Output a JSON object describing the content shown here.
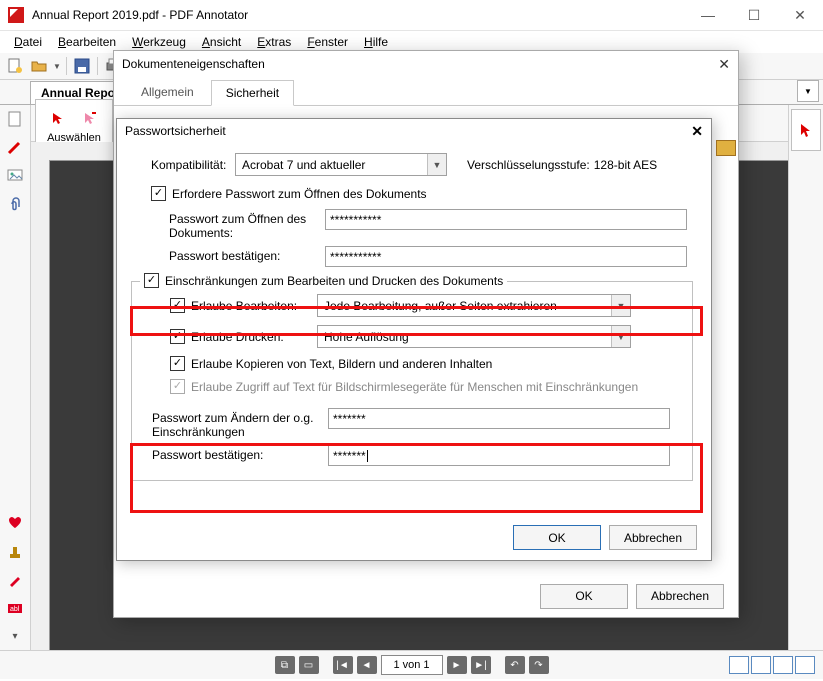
{
  "app": {
    "title": "Annual Report 2019.pdf - PDF Annotator"
  },
  "menubar": [
    "Datei",
    "Bearbeiten",
    "Werkzeug",
    "Ansicht",
    "Extras",
    "Fenster",
    "Hilfe"
  ],
  "doc_tab": "Annual Report",
  "tool_label": "Auswählen",
  "dlg_props": {
    "title": "Dokumenteneigenschaften",
    "tabs": [
      "Allgemein",
      "Sicherheit"
    ],
    "active_tab_index": 1,
    "ok": "OK",
    "cancel": "Abbrechen"
  },
  "dlg_sec": {
    "title": "Passwortsicherheit",
    "compat_label": "Kompatibilität:",
    "compat_value": "Acrobat 7 und aktueller",
    "enc_label": "Verschlüsselungsstufe:",
    "enc_value": "128-bit AES",
    "require_open_pw": "Erfordere Passwort zum Öffnen des Dokuments",
    "open_pw_label": "Passwort zum Öffnen des Dokuments:",
    "open_pw_value": "***********",
    "confirm_pw_label": "Passwort bestätigen:",
    "confirm_pw_value": "***********",
    "restrict_legend": "Einschränkungen zum Bearbeiten und Drucken des Dokuments",
    "allow_edit_label": "Erlaube Bearbeiten:",
    "allow_edit_value": "Jede  Bearbeitung, außer Seiten extrahieren",
    "allow_print_label": "Erlaube Drucken:",
    "allow_print_value": "Hohe Auflösung",
    "allow_copy": "Erlaube Kopieren von Text, Bildern und anderen Inhalten",
    "allow_access": "Erlaube Zugriff auf Text für Bildschirmlesegeräte für Menschen mit Einschränkungen",
    "perm_pw_label": "Passwort zum Ändern der o.g. Einschränkungen",
    "perm_pw_value": "*******",
    "perm_confirm_label": "Passwort bestätigen:",
    "perm_confirm_value": "*******",
    "ok": "OK",
    "cancel": "Abbrechen"
  },
  "pager": {
    "page_text": "1 von 1"
  }
}
